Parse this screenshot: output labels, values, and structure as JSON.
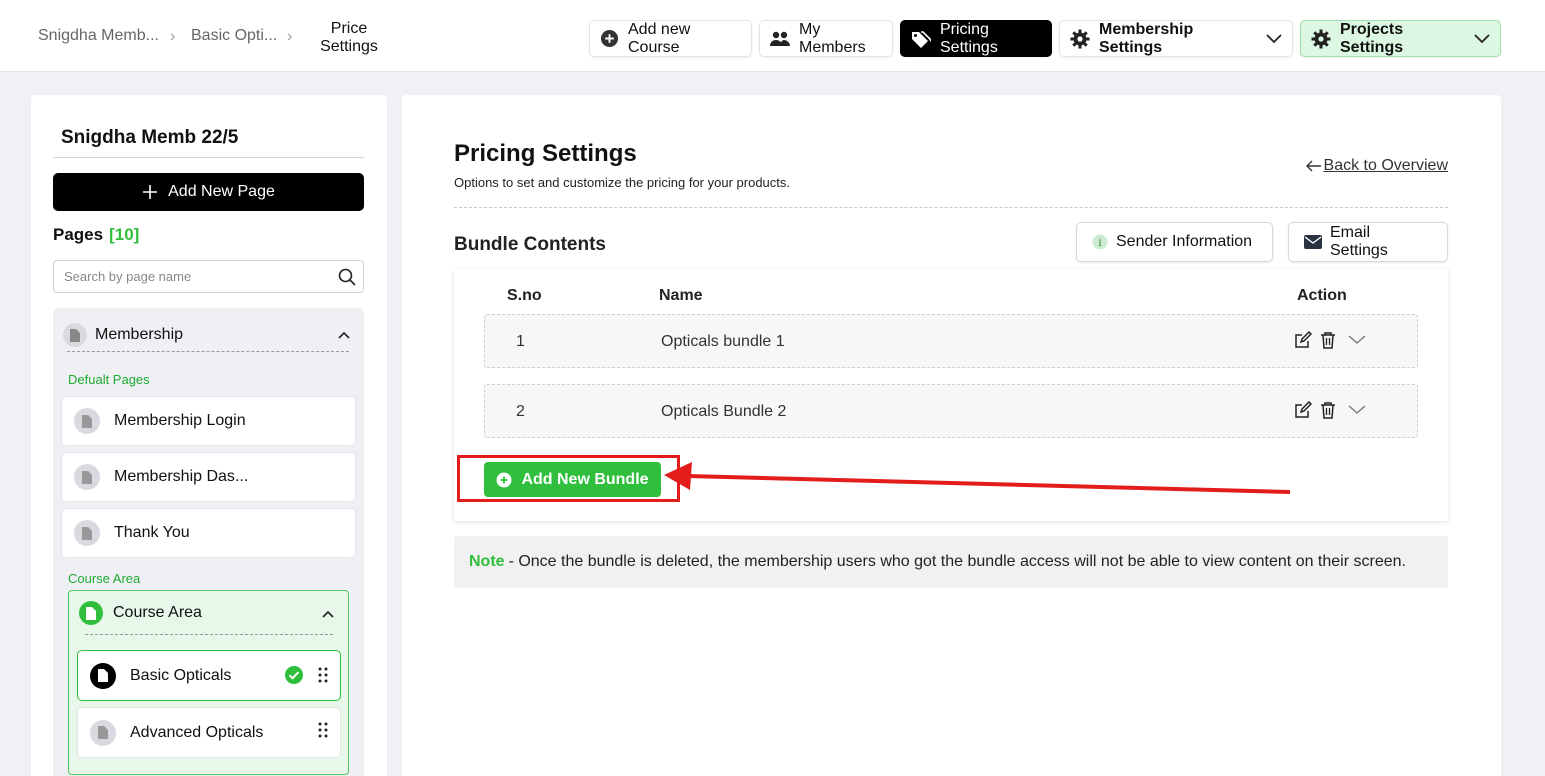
{
  "breadcrumb": {
    "items": [
      "Snigdha Memb...",
      "Basic Opti...",
      "Price Settings"
    ]
  },
  "topbar": {
    "add_course": "Add new Course",
    "my_members": "My Members",
    "pricing_settings": "Pricing Settings",
    "membership_settings": "Membership Settings",
    "projects_settings": "Projects Settings"
  },
  "sidebar": {
    "project_title": "Snigdha Memb 22/5",
    "add_page": "Add New Page",
    "pages_label": "Pages",
    "pages_count": "[10]",
    "search_placeholder": "Search by page name",
    "group_title": "Membership",
    "default_pages_label": "Defualt Pages",
    "default_pages": [
      "Membership Login",
      "Membership Das...",
      "Thank You"
    ],
    "course_area_label": "Course Area",
    "course_area_title": "Course Area",
    "course_pages": [
      "Basic Opticals",
      "Advanced Opticals"
    ]
  },
  "main": {
    "title": "Pricing Settings",
    "subtitle": "Options to set and customize the pricing for your products.",
    "back_link": "Back to Overview",
    "bundle_title": "Bundle Contents",
    "sender_info": "Sender Information",
    "email_settings": "Email Settings",
    "table": {
      "headers": [
        "S.no",
        "Name",
        "Action"
      ],
      "rows": [
        {
          "sno": "1",
          "name": "Opticals bundle 1"
        },
        {
          "sno": "2",
          "name": "Opticals Bundle 2"
        }
      ]
    },
    "add_bundle": "Add New Bundle",
    "note_label": "Note",
    "note_text": "- Once the bundle is deleted, the membership users who got the bundle access will not be able to view content on their screen."
  },
  "colors": {
    "accent_green": "#2fbf3d",
    "annotation_red": "#e31c1c",
    "dark": "#000000"
  }
}
